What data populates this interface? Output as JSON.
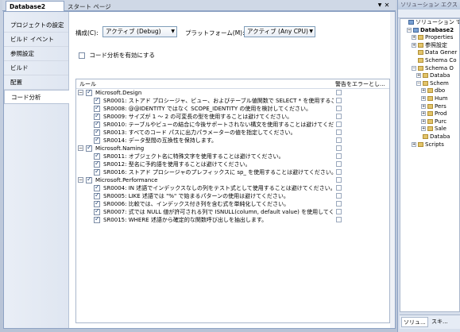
{
  "tabs": {
    "active": "Database2",
    "inactive": "スタート ページ"
  },
  "sidebar": {
    "items": [
      {
        "label": "プロジェクトの設定"
      },
      {
        "label": "ビルド イベント"
      },
      {
        "label": "参照設定"
      },
      {
        "label": "ビルド"
      },
      {
        "label": "配置"
      },
      {
        "label": "コード分析"
      }
    ]
  },
  "config": {
    "config_label": "構成(C):",
    "config_value": "アクティブ (Debug)",
    "platform_label": "プラットフォーム(M):",
    "platform_value": "アクティブ (Any CPU)"
  },
  "enable_label": "コード分析を有効にする",
  "grid": {
    "col_rule": "ルール",
    "col_error": "警告をエラーとし...",
    "categories": [
      {
        "name": "Microsoft.Design",
        "rules": [
          "SR0001: ストアド プロシージャ、ビュー、およびテーブル値関数で SELECT * を使用することは",
          "SR0008: @@IDENTITY ではなく SCOPE_IDENTITY の使用を検討してください。",
          "SR0009: サイズが 1 ～ 2 の可変長の型を使用することは避けてください。",
          "SR0010: テーブルやビューの結合に今後サポートされない構文を使用することは避けてください。",
          "SR0013: すべてのコード パスに出力パラメーターの値を指定してください。",
          "SR0014: データ型間の互換性を保持します。"
        ]
      },
      {
        "name": "Microsoft.Naming",
        "rules": [
          "SR0011: オブジェクト名に特殊文字を使用することは避けてください。",
          "SR0012: 型名に予約語を使用することは避けてください。",
          "SR0016: ストアド プロシージャのプレフィックスに sp_ を使用することは避けてください。"
        ]
      },
      {
        "name": "Microsoft.Performance",
        "rules": [
          "SR0004: IN 述語でインデックスなしの列をテスト式として使用することは避けてください。",
          "SR0005: LIKE 述語では \"%\" で始まるパターンの使用は避けてください。",
          "SR0006: 比較では、インデックス付き列を含む式を単純化してください。",
          "SR0007: 式では NULL 値が許可される列で ISNULL(column, default value) を使用してください",
          "SR0015: WHERE 述語から確定的な関数呼び出しを抽出します。"
        ]
      }
    ]
  },
  "explorer": {
    "title": "ソリューション エクス",
    "tree": [
      {
        "label": "ソリューション 'Data",
        "indent": 0,
        "icon": "solution-icon",
        "pm": ""
      },
      {
        "label": "Database2",
        "indent": 1,
        "icon": "project-icon",
        "pm": "-",
        "bold": true
      },
      {
        "label": "Properties",
        "indent": 2,
        "icon": "folder-icon",
        "pm": "+"
      },
      {
        "label": "参照設定",
        "indent": 2,
        "icon": "folder-icon",
        "pm": "+"
      },
      {
        "label": "Data Gener",
        "indent": 2,
        "icon": "folder-icon",
        "pm": ""
      },
      {
        "label": "Schema Co",
        "indent": 2,
        "icon": "folder-icon",
        "pm": ""
      },
      {
        "label": "Schema O",
        "indent": 2,
        "icon": "folder-icon",
        "pm": "-"
      },
      {
        "label": "Databa",
        "indent": 3,
        "icon": "folder-icon",
        "pm": "+"
      },
      {
        "label": "Schem",
        "indent": 3,
        "icon": "folder-icon",
        "pm": "-"
      },
      {
        "label": "dbo",
        "indent": 4,
        "icon": "folder-icon",
        "pm": "+"
      },
      {
        "label": "Hum",
        "indent": 4,
        "icon": "folder-icon",
        "pm": "+"
      },
      {
        "label": "Pers",
        "indent": 4,
        "icon": "folder-icon",
        "pm": "+"
      },
      {
        "label": "Prod",
        "indent": 4,
        "icon": "folder-icon",
        "pm": "+"
      },
      {
        "label": "Purc",
        "indent": 4,
        "icon": "folder-icon",
        "pm": "+"
      },
      {
        "label": "Sale",
        "indent": 4,
        "icon": "folder-icon",
        "pm": "+"
      },
      {
        "label": "Databa",
        "indent": 3,
        "icon": "folder-icon",
        "pm": ""
      },
      {
        "label": "Scripts",
        "indent": 2,
        "icon": "folder-icon",
        "pm": "+"
      }
    ],
    "bottom_tabs": [
      "ソリュ...",
      "スキ..."
    ]
  },
  "colors": {
    "accent": "#8ea3c4",
    "sidebar_bg": "#e9eef6"
  }
}
